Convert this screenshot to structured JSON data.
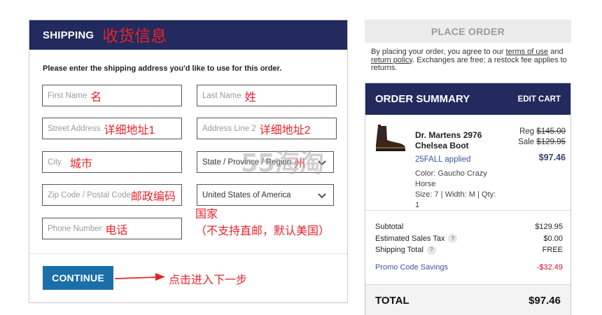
{
  "shipping": {
    "title": "SHIPPING",
    "title_note": "收货信息",
    "instructions": "Please enter the shipping address you'd like to use for this order.",
    "fields": {
      "first_name": {
        "placeholder": "First Name",
        "note": "名"
      },
      "last_name": {
        "placeholder": "Last Name",
        "note": "姓"
      },
      "street_address": {
        "placeholder": "Street Address",
        "note": "详细地址1"
      },
      "address_line2": {
        "placeholder": "Address Line 2",
        "note": "详细地址2"
      },
      "city": {
        "placeholder": "City",
        "note": "城市"
      },
      "state": {
        "value": "State / Province / Region",
        "note": "州"
      },
      "zip": {
        "placeholder": "Zip Code / Postal Code",
        "note": "邮政编码"
      },
      "country": {
        "value": "United States of America"
      },
      "phone": {
        "placeholder": "Phone Number",
        "note": "电话"
      }
    },
    "country_note_line1": "国家",
    "country_note_line2": "（不支持直邮，默认美国）",
    "continue_label": "CONTINUE",
    "next_step_note": "点击进入下一步"
  },
  "watermark": "55海淘",
  "place_order_label": "PLACE ORDER",
  "agreement": {
    "prefix": "By placing your order, you agree to our ",
    "terms_link": "terms of use",
    "middle": " and ",
    "return_link": "return policy",
    "suffix": ". Exchanges are free; a restock fee applies to returns."
  },
  "order_summary": {
    "title": "ORDER SUMMARY",
    "edit_cart": "EDIT CART",
    "item": {
      "name": "Dr. Martens 2976 Chelsea Boot",
      "promo_applied": "25FALL applied",
      "color": "Color: Gaucho Crazy Horse",
      "size_line": "Size: 7 | Width: M | Qty: 1",
      "reg_label": "Reg",
      "reg_price": "$145.00",
      "sale_label": "Sale",
      "sale_price": "$129.95",
      "final_price": "$97.46"
    },
    "subtotal_label": "Subtotal",
    "subtotal_value": "$129.95",
    "tax_label": "Estimated Sales Tax",
    "tax_value": "$0.00",
    "shipping_label": "Shipping Total",
    "shipping_value": "FREE",
    "help_glyph": "?",
    "promo_savings_label": "Promo Code Savings",
    "promo_savings_value": "-$32.49",
    "total_label": "TOTAL",
    "total_value": "$97.46"
  },
  "colors": {
    "header_navy": "#222a5e",
    "continue_blue": "#1a6fa8",
    "annotation_red": "#e8232a",
    "link_blue": "#3a56a5"
  }
}
